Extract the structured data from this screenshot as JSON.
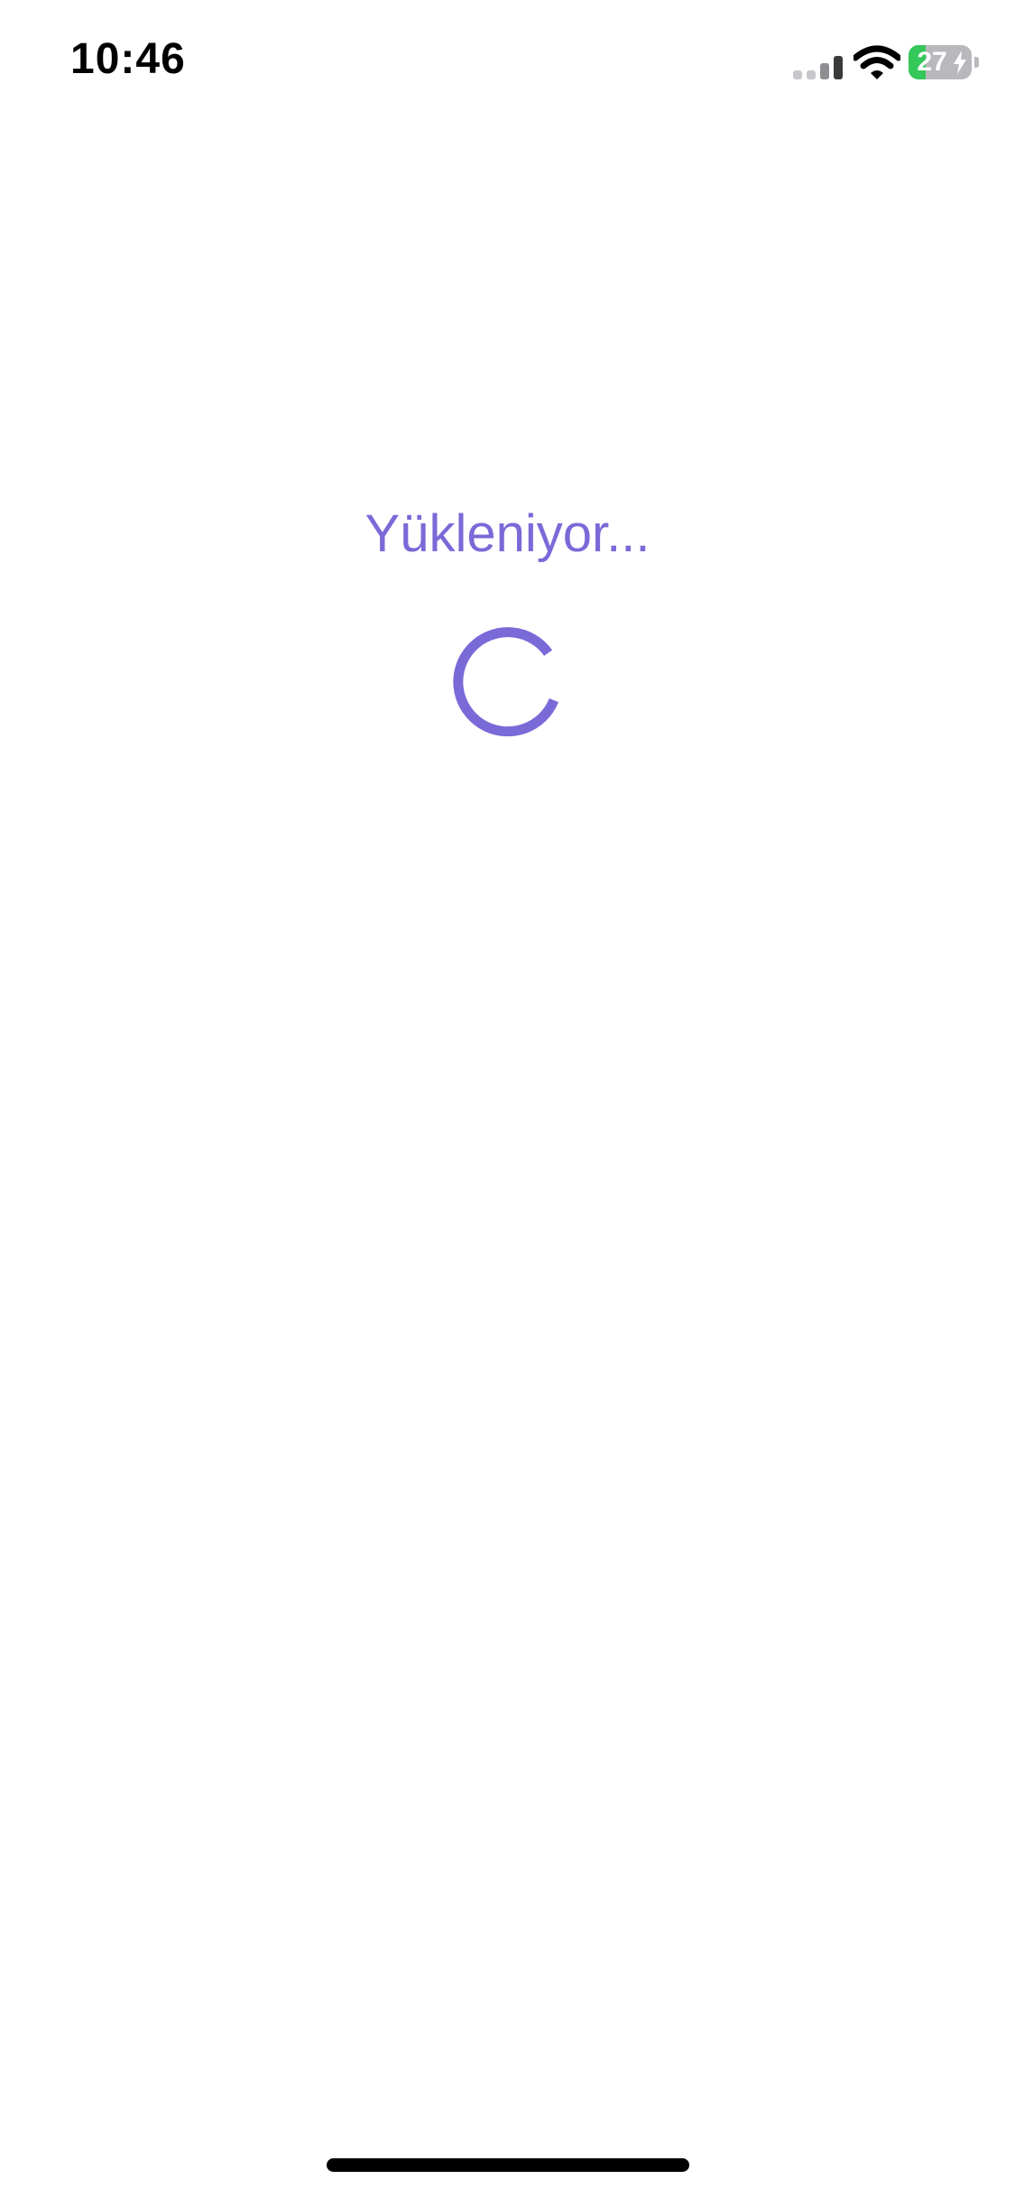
{
  "status_bar": {
    "time": "10:46",
    "battery_text": "27",
    "battery_level": 0.27,
    "icons": [
      "signal-icon",
      "wifi-icon",
      "battery-icon",
      "charging-bolt-icon"
    ]
  },
  "loading": {
    "text": "Yükleniyor...",
    "icon": "spinner-icon"
  },
  "colors": {
    "accent": "#7a6ad8",
    "background": "#ffffff",
    "battery_fill": "#34c759",
    "battery_empty": "#b9b9bd"
  }
}
